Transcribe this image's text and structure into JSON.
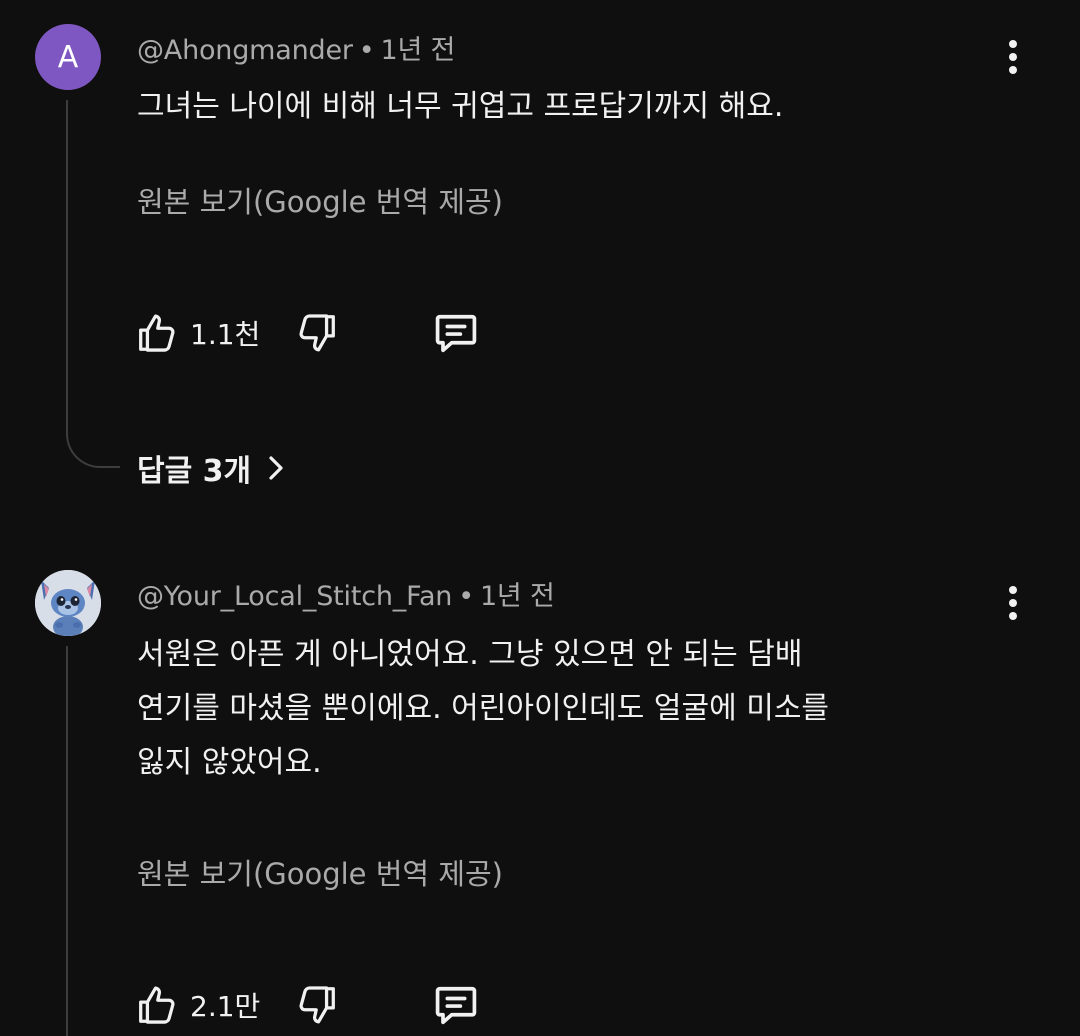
{
  "comments": [
    {
      "avatar_letter": "A",
      "author": "@Ahongmander",
      "time": "1년 전",
      "lines": [
        "그녀는 나이에 비해 너무 귀엽고 프로답기까지 해요."
      ],
      "translate_label": "원본 보기(Google 번역 제공)",
      "likes": "1.1천",
      "replies_label": "답글 3개",
      "avatar_color": "#7e57c2"
    },
    {
      "author": "@Your_Local_Stitch_Fan",
      "time": "1년 전",
      "lines": [
        "서원은 아픈 게 아니었어요. 그냥 있으면 안 되는 담배",
        "연기를 마셨을 뿐이에요. 어린아이인데도 얼굴에 미소를",
        "잃지 않았어요."
      ],
      "translate_label": "원본 보기(Google 번역 제공)",
      "likes": "2.1만"
    }
  ],
  "separator": "•",
  "icons": {
    "like": "thumbs-up-icon",
    "dislike": "thumbs-down-icon",
    "reply": "comment-icon",
    "more": "more-vert-icon",
    "chevron": "chevron-right-icon"
  }
}
